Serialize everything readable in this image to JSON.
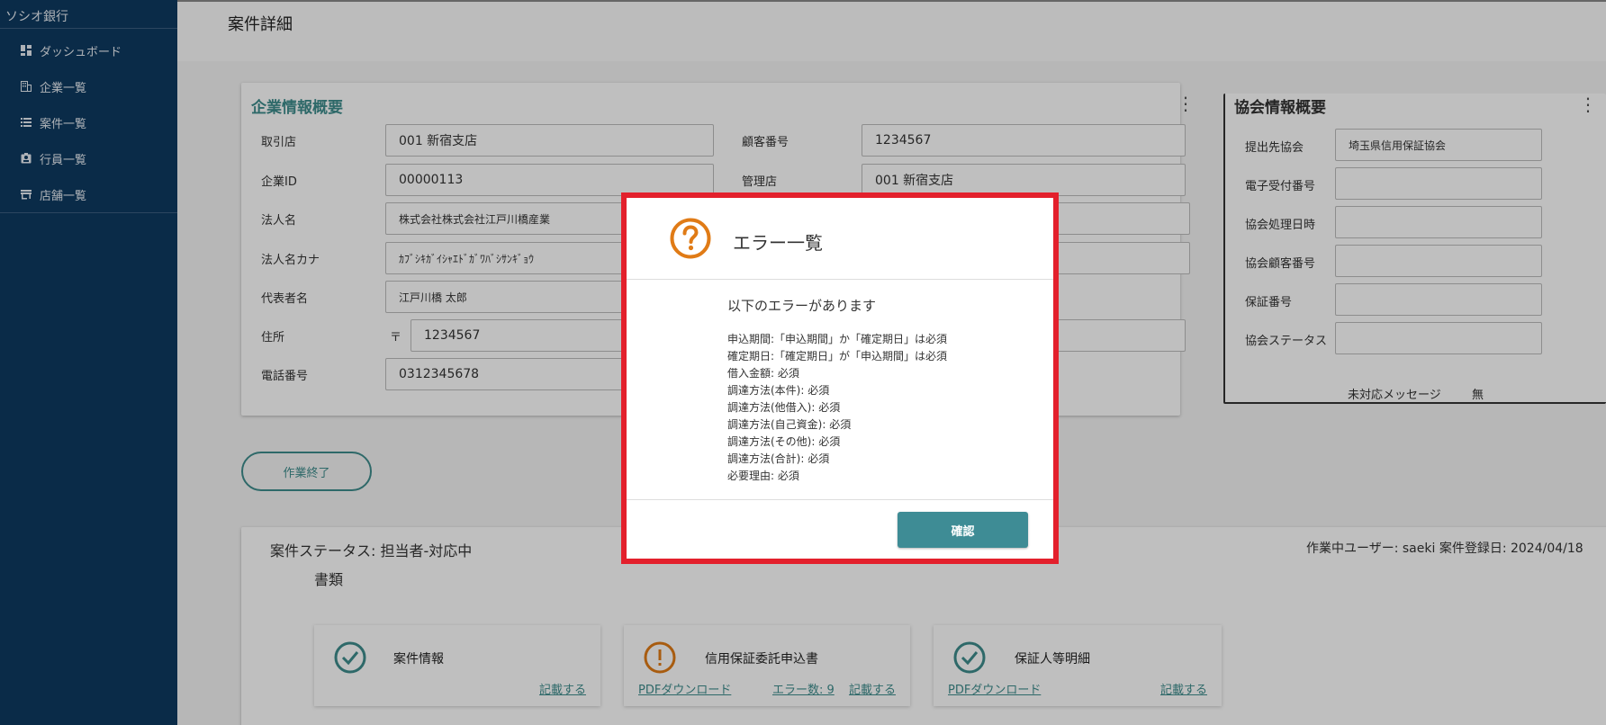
{
  "sidebar": {
    "brand": "ソシオ銀行",
    "items": [
      {
        "label": "ダッシュボード",
        "icon": "dashboard-icon"
      },
      {
        "label": "企業一覧",
        "icon": "building-icon"
      },
      {
        "label": "案件一覧",
        "icon": "list-icon"
      },
      {
        "label": "行員一覧",
        "icon": "badge-icon"
      },
      {
        "label": "店舗一覧",
        "icon": "store-icon"
      }
    ]
  },
  "page": {
    "title": "案件詳細"
  },
  "company": {
    "title": "企業情報概要",
    "fields": {
      "branch": {
        "label": "取引店",
        "value": "001 新宿支店"
      },
      "customer_no": {
        "label": "顧客番号",
        "value": "1234567"
      },
      "company_id": {
        "label": "企業ID",
        "value": "00000113"
      },
      "managing_branch": {
        "label": "管理店",
        "value": "001 新宿支店"
      },
      "corp_name": {
        "label": "法人名",
        "value": "株式会社株式会社江戸川橋産業"
      },
      "corp_kana": {
        "label": "法人名カナ",
        "value": "ｶﾌﾞｼｷｶﾞｲｼｬｴﾄﾞｶﾞﾜﾊﾞｼｻﾝｷﾞｮｳ"
      },
      "representative": {
        "label": "代表者名",
        "value": "江戸川橋 太郎"
      },
      "address": {
        "label": "住所",
        "postal_mark": "〒",
        "value": "1234567"
      },
      "phone": {
        "label": "電話番号",
        "value": "0312345678"
      }
    }
  },
  "association": {
    "title": "協会情報概要",
    "fields": [
      {
        "label": "提出先協会",
        "value": "埼玉県信用保証協会"
      },
      {
        "label": "電子受付番号",
        "value": ""
      },
      {
        "label": "協会処理日時",
        "value": ""
      },
      {
        "label": "協会顧客番号",
        "value": ""
      },
      {
        "label": "保証番号",
        "value": ""
      },
      {
        "label": "協会ステータス",
        "value": ""
      }
    ],
    "message_label": "未対応メッセージ",
    "message_value": "無"
  },
  "actions": {
    "finish_label": "作業終了"
  },
  "status": {
    "status_text": "案件ステータス: 担当者-対応中",
    "docs_label": "書類",
    "user_info": "作業中ユーザー: saeki  案件登録日: 2024/04/18"
  },
  "documents": [
    {
      "title": "案件情報",
      "state": "ok",
      "links": [
        "記載する"
      ]
    },
    {
      "title": "信用保証委託申込書",
      "state": "warning",
      "links": [
        "PDFダウンロード",
        "エラー数: 9",
        "記載する"
      ]
    },
    {
      "title": "保証人等明細",
      "state": "ok",
      "links": [
        "PDFダウンロード",
        "記載する"
      ]
    }
  ],
  "colors": {
    "sidebar_bg": "#0e3a60",
    "accent_teal": "#3e8c8c",
    "warning_orange": "#e07b16",
    "modal_border": "#e3202c"
  },
  "modal": {
    "icon": "question-circle-icon",
    "title": "エラー一覧",
    "intro": "以下のエラーがあります",
    "errors": [
      "申込期間:「申込期間」か「確定期日」は必須",
      "確定期日:「確定期日」が「申込期間」は必須",
      "借入金額: 必須",
      "調達方法(本件): 必須",
      "調達方法(他借入): 必須",
      "調達方法(自己資金): 必須",
      "調達方法(その他): 必須",
      "調達方法(合計): 必須",
      "必要理由: 必須"
    ],
    "confirm_label": "確認"
  }
}
